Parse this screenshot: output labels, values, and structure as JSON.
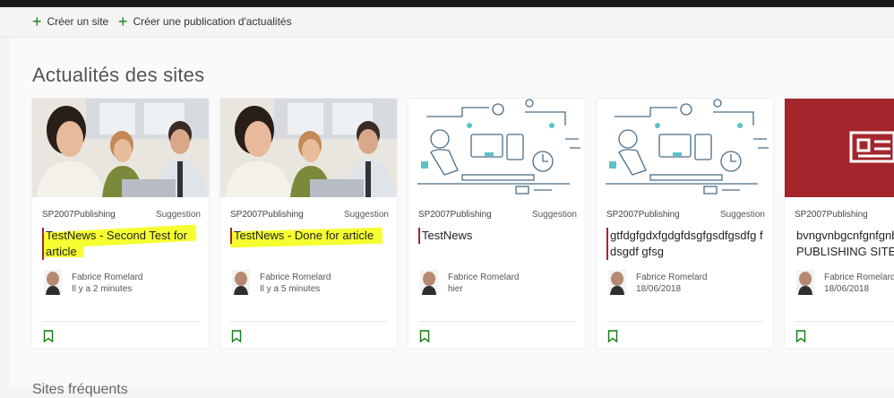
{
  "commands": {
    "create_site": "Créer un site",
    "create_news": "Créer une publication d'actualités"
  },
  "section_title": "Actualités des sites",
  "bottom_section_title": "Sites fréquents",
  "cards": [
    {
      "site": "SP2007Publishing",
      "tag": "Suggestion",
      "title": "TestNews - Second Test for article",
      "author": "Fabrice Romelard",
      "time": "Il y a 2 minutes"
    },
    {
      "site": "SP2007Publishing",
      "tag": "Suggestion",
      "title": "TestNews - Done for article",
      "author": "Fabrice Romelard",
      "time": "Il y a 5 minutes"
    },
    {
      "site": "SP2007Publishing",
      "tag": "Suggestion",
      "title": "TestNews",
      "author": "Fabrice Romelard",
      "time": "hier"
    },
    {
      "site": "SP2007Publishing",
      "tag": "Suggestion",
      "title": "gtfdgfgdxfgdgfdsgfgsdfgsdfg fdsgdf gfsg",
      "author": "Fabrice Romelard",
      "time": "18/06/2018"
    },
    {
      "site": "SP2007Publishing",
      "tag": "",
      "title": "bvngvnbgcnfgnfgnbv PUBLISHING SITE",
      "author": "Fabrice Romelard",
      "time": "18/06/2018"
    }
  ],
  "colors": {
    "accent_red": "#a4262c",
    "green": "#107c10",
    "highlight": "#f5ff2f"
  },
  "icons": [
    "plus-icon",
    "bookmark-icon",
    "newspaper-icon"
  ]
}
